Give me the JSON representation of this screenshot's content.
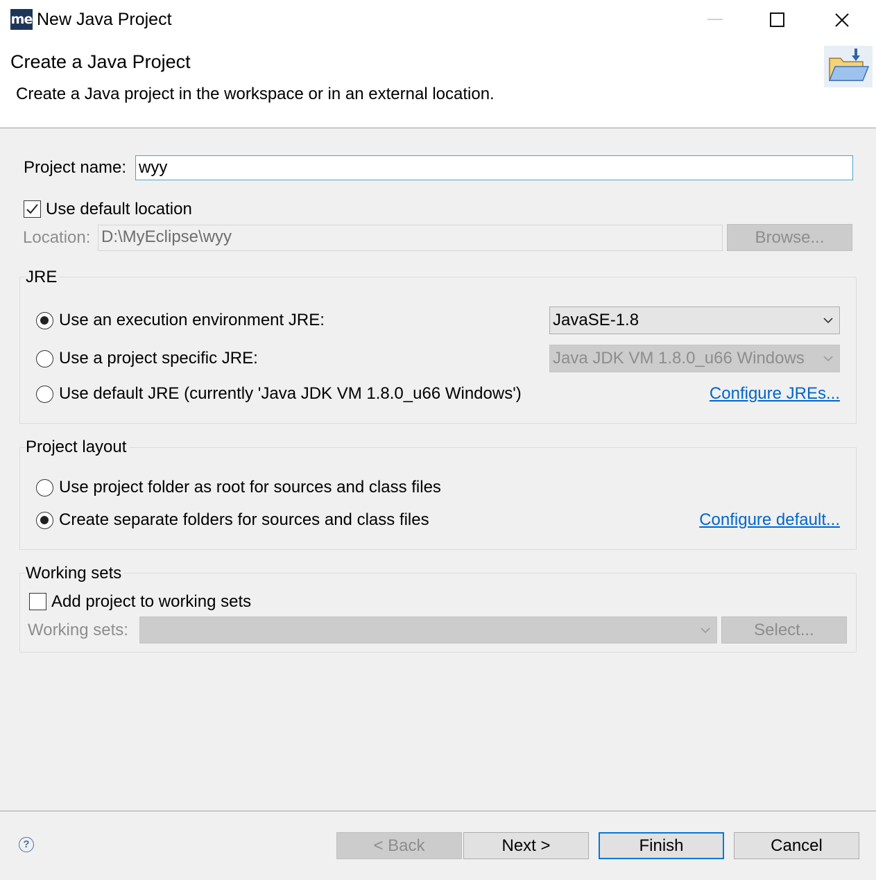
{
  "window": {
    "app_icon_text": "me",
    "title": "New Java Project"
  },
  "header": {
    "title": "Create a Java Project",
    "description": "Create a Java project in the workspace or in an external location."
  },
  "project": {
    "name_label": "Project name:",
    "name_value": "wyy",
    "use_default_location_label": "Use default location",
    "use_default_location_checked": true,
    "location_label": "Location:",
    "location_value": "D:\\MyEclipse\\wyy",
    "browse_label": "Browse..."
  },
  "jre": {
    "group_title": "JRE",
    "options": [
      {
        "label": "Use an execution environment JRE:",
        "selected": true
      },
      {
        "label": "Use a project specific JRE:",
        "selected": false
      },
      {
        "label": "Use default JRE (currently 'Java JDK VM 1.8.0_u66 Windows')",
        "selected": false
      }
    ],
    "execution_env_value": "JavaSE-1.8",
    "project_specific_value": "Java JDK VM 1.8.0_u66 Windows",
    "configure_link": "Configure JREs..."
  },
  "layout": {
    "group_title": "Project layout",
    "options": [
      {
        "label": "Use project folder as root for sources and class files",
        "selected": false
      },
      {
        "label": "Create separate folders for sources and class files",
        "selected": true
      }
    ],
    "configure_link": "Configure default..."
  },
  "working_sets": {
    "group_title": "Working sets",
    "add_label": "Add project to working sets",
    "add_checked": false,
    "sets_label": "Working sets:",
    "sets_value": "",
    "select_label": "Select..."
  },
  "footer": {
    "help_icon": "?",
    "back_label": "< Back",
    "next_label": "Next >",
    "finish_label": "Finish",
    "cancel_label": "Cancel"
  },
  "colors": {
    "link": "#0066cc",
    "accent": "#0078d7"
  }
}
